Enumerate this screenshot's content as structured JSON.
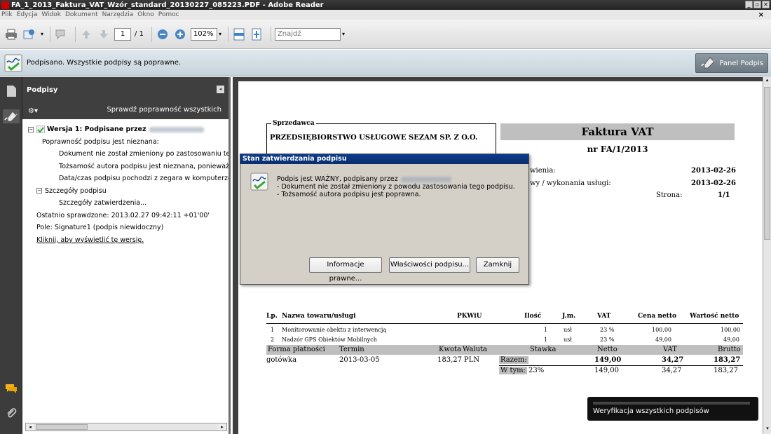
{
  "window": {
    "title": "FA_1_2013_Faktura_VAT_Wzór_standard_20130227_085223.PDF - Adobe Reader"
  },
  "menu": [
    "Plik",
    "Edycja",
    "Widok",
    "Dokument",
    "Narzędzia",
    "Okno",
    "Pomoc"
  ],
  "toolbar": {
    "page_current": "1",
    "page_total": "/ 1",
    "zoom": "102%",
    "search_placeholder": "Znajdź"
  },
  "message_bar": {
    "text": "Podpisano. Wszystkie podpisy są poprawne.",
    "panel_button": "Panel Podpis"
  },
  "signature_panel": {
    "title": "Podpisy",
    "verify_all": "Sprawdź poprawność wszystkich",
    "version_label": "Wersja 1: Podpisane przez",
    "validity_unknown": "Poprawność podpisu jest nieznana:",
    "doc_not_changed": "Dokument nie został zmieniony po zastosowaniu tego p",
    "identity_unknown": "Tożsamość autora podpisu jest nieznana, ponieważ nie",
    "time_from_clock": "Data/czas podpisu pochodzi z zegara w komputerze aut",
    "details_label": "Szczegóły podpisu",
    "validation_details": "Szczegóły zatwierdzenia...",
    "last_checked": "Ostatnio sprawdzone: 2013.02.27 09:42:11 +01'00'",
    "field": "Pole: Signature1 (podpis niewidoczny)",
    "click_versions": "Kliknij, aby wyświetlić tę wersję."
  },
  "document": {
    "seller_label": "Sprzedawca",
    "seller_name": "PRZEDSIĘBIORSTWO USŁUGOWE SEZAM SP. Z O.O.",
    "invoice_title": "Faktura VAT",
    "invoice_number": "nr FA/1/2013",
    "issue_label": "wienia:",
    "issue_date": "2013-02-26",
    "service_label": "wy / wykonania usługi:",
    "service_date": "2013-02-26",
    "page_label": "Strona:",
    "page_value": "1/1",
    "table_headers": [
      "Lp.",
      "Nazwa towaru/usługi",
      "PKWiU",
      "Ilość",
      "J.m.",
      "VAT",
      "Cena netto",
      "Wartość netto"
    ],
    "rows": [
      {
        "lp": "1",
        "name": "Monitorowanie obektu z interwencją",
        "qty": "1",
        "unit": "usł",
        "vat": "23 %",
        "price": "100,00",
        "value": "100,00"
      },
      {
        "lp": "2",
        "name": "Nadzór GPS Obiektów Mobilnych",
        "qty": "1",
        "unit": "usł",
        "vat": "23 %",
        "price": "49,00",
        "value": "49,00"
      }
    ],
    "payment_headers": [
      "Forma płatności",
      "Termin",
      "Kwota",
      "Waluta",
      "Stawka",
      "Netto",
      "VAT",
      "Brutto"
    ],
    "payment": {
      "form": "gotówka",
      "term": "2013-03-05",
      "amount": "183,27",
      "currency": "PLN"
    },
    "total_label": "Razem:",
    "total_net": "149,00",
    "total_vat": "34,27",
    "total_gross": "183,27",
    "incl_label": "W tym:",
    "incl_rate": "23%",
    "incl_net": "149,00",
    "incl_vat": "34,27",
    "incl_gross": "183,27"
  },
  "dialog": {
    "title": "Stan zatwierdzania podpisu",
    "line1": "Podpis jest WAŻNY, podpisany przez",
    "line2": "- Dokument nie został zmieniony z powodu zastosowania tego podpisu.",
    "line3": "- Tożsamość autora podpisu jest poprawna.",
    "btn_legal": "Informacje prawne...",
    "btn_properties": "Właściwości podpisu...",
    "btn_close": "Zamknij"
  },
  "toast": {
    "text": "Weryfikacja wszystkich podpisów"
  }
}
